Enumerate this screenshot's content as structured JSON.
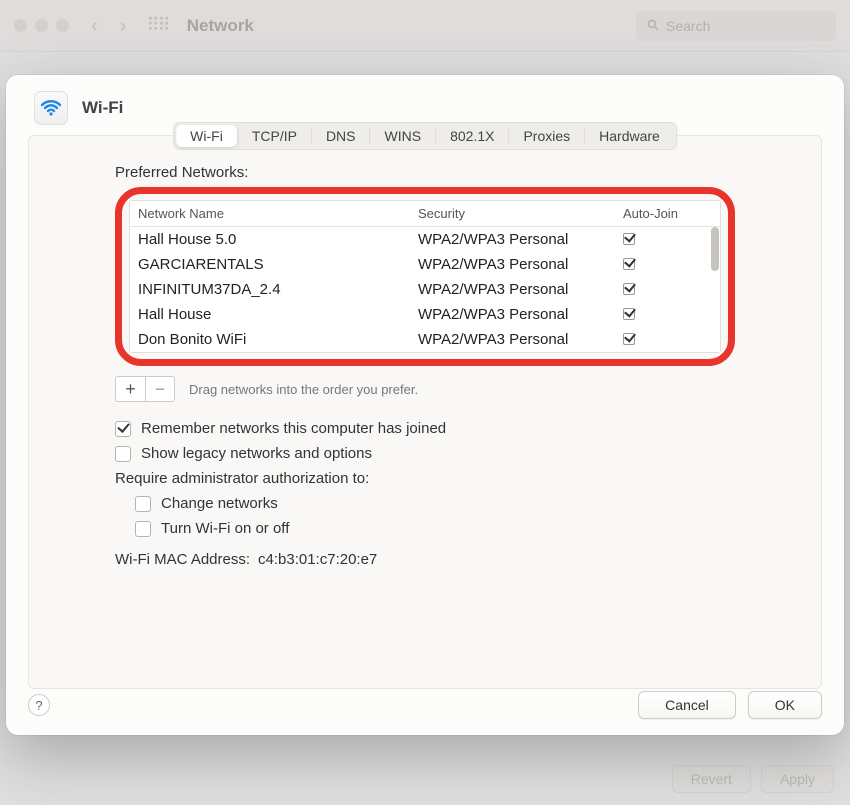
{
  "parent": {
    "title": "Network",
    "search_placeholder": "Search",
    "footer": {
      "revert": "Revert",
      "apply": "Apply"
    }
  },
  "sheet": {
    "title": "Wi-Fi",
    "tabs": [
      "Wi-Fi",
      "TCP/IP",
      "DNS",
      "WINS",
      "802.1X",
      "Proxies",
      "Hardware"
    ],
    "section_label": "Preferred Networks:",
    "table": {
      "headers": {
        "name": "Network Name",
        "security": "Security",
        "autojoin": "Auto-Join"
      },
      "rows": [
        {
          "name": "Hall House 5.0",
          "security": "WPA2/WPA3 Personal",
          "autojoin": true
        },
        {
          "name": "GARCIARENTALS",
          "security": "WPA2/WPA3 Personal",
          "autojoin": true
        },
        {
          "name": "INFINITUM37DA_2.4",
          "security": "WPA2/WPA3 Personal",
          "autojoin": true
        },
        {
          "name": "Hall House",
          "security": "WPA2/WPA3 Personal",
          "autojoin": true
        },
        {
          "name": "Don Bonito WiFi",
          "security": "WPA2/WPA3 Personal",
          "autojoin": true
        }
      ]
    },
    "drag_hint": "Drag networks into the order you prefer.",
    "remember_label": "Remember networks this computer has joined",
    "legacy_label": "Show legacy networks and options",
    "require_label": "Require administrator authorization to:",
    "change_networks_label": "Change networks",
    "turn_wifi_label": "Turn Wi-Fi on or off",
    "mac_label": "Wi-Fi MAC Address:",
    "mac_value": "c4:b3:01:c7:20:e7",
    "footer": {
      "cancel": "Cancel",
      "ok": "OK"
    }
  }
}
